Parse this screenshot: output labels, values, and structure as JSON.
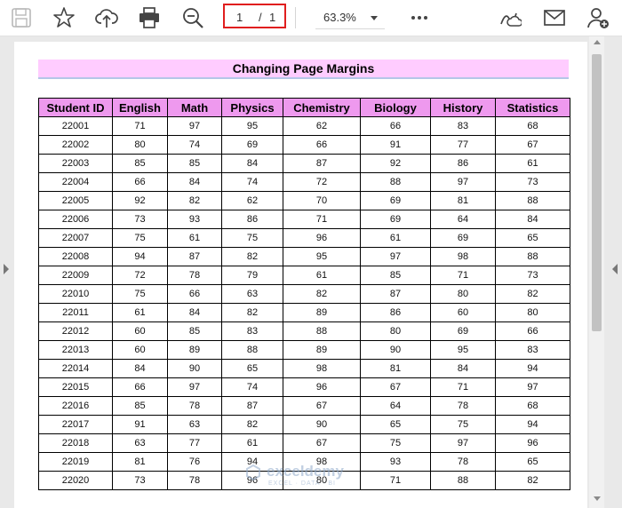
{
  "toolbar": {
    "icons": [
      "save-icon",
      "bookmark-star-icon",
      "upload-cloud-icon",
      "print-icon",
      "zoom-out-icon",
      "more-icon",
      "sign-icon",
      "email-icon",
      "add-user-icon"
    ],
    "page_current": "1",
    "page_separator": "/",
    "page_total": "1",
    "zoom_value": "63.3%"
  },
  "document": {
    "title": "Changing Page Margins",
    "headers": [
      "Student ID",
      "English",
      "Math",
      "Physics",
      "Chemistry",
      "Biology",
      "History",
      "Statistics"
    ],
    "rows": [
      [
        "22001",
        "71",
        "97",
        "95",
        "62",
        "66",
        "83",
        "68"
      ],
      [
        "22002",
        "80",
        "74",
        "69",
        "66",
        "91",
        "77",
        "67"
      ],
      [
        "22003",
        "85",
        "85",
        "84",
        "87",
        "92",
        "86",
        "61"
      ],
      [
        "22004",
        "66",
        "84",
        "74",
        "72",
        "88",
        "97",
        "73"
      ],
      [
        "22005",
        "92",
        "82",
        "62",
        "70",
        "69",
        "81",
        "88"
      ],
      [
        "22006",
        "73",
        "93",
        "86",
        "71",
        "69",
        "64",
        "84"
      ],
      [
        "22007",
        "75",
        "61",
        "75",
        "96",
        "61",
        "69",
        "65"
      ],
      [
        "22008",
        "94",
        "87",
        "82",
        "95",
        "97",
        "98",
        "88"
      ],
      [
        "22009",
        "72",
        "78",
        "79",
        "61",
        "85",
        "71",
        "73"
      ],
      [
        "22010",
        "75",
        "66",
        "63",
        "82",
        "87",
        "80",
        "82"
      ],
      [
        "22011",
        "61",
        "84",
        "82",
        "89",
        "86",
        "60",
        "80"
      ],
      [
        "22012",
        "60",
        "85",
        "83",
        "88",
        "80",
        "69",
        "66"
      ],
      [
        "22013",
        "60",
        "89",
        "88",
        "89",
        "90",
        "95",
        "83"
      ],
      [
        "22014",
        "84",
        "90",
        "65",
        "98",
        "81",
        "84",
        "94"
      ],
      [
        "22015",
        "66",
        "97",
        "74",
        "96",
        "67",
        "71",
        "97"
      ],
      [
        "22016",
        "85",
        "78",
        "87",
        "67",
        "64",
        "78",
        "68"
      ],
      [
        "22017",
        "91",
        "63",
        "82",
        "90",
        "65",
        "75",
        "94"
      ],
      [
        "22018",
        "63",
        "77",
        "61",
        "67",
        "75",
        "97",
        "96"
      ],
      [
        "22019",
        "81",
        "76",
        "94",
        "98",
        "93",
        "78",
        "65"
      ],
      [
        "22020",
        "73",
        "78",
        "96",
        "80",
        "71",
        "88",
        "82"
      ]
    ],
    "watermark_name": "exceldemy",
    "watermark_tag": "EXCEL · DATA · BI"
  },
  "colors": {
    "highlight_border": "#e01e1e",
    "title_fill": "#ffccff",
    "header_fill": "#ee99ee",
    "viewer_bg": "#e9e9e9"
  }
}
